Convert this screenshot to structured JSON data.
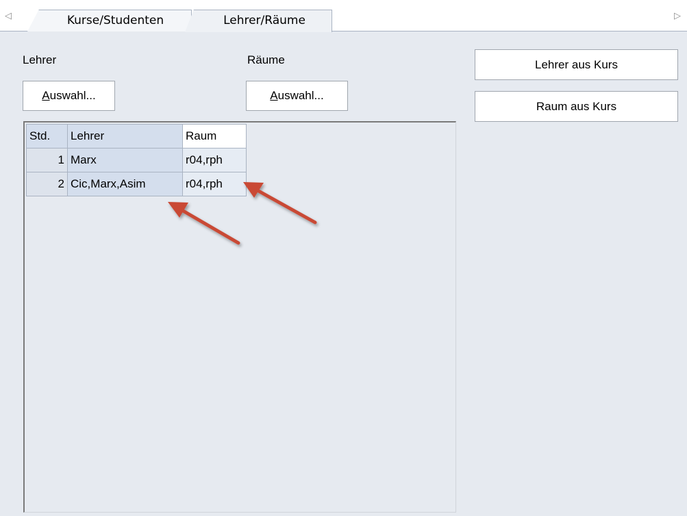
{
  "tabs": [
    {
      "label": "Kurse/Studenten",
      "active": false
    },
    {
      "label": "Lehrer/Räume",
      "active": true
    }
  ],
  "icons": {
    "scroll_left": "triangle-left-icon",
    "scroll_right": "triangle-right-icon"
  },
  "lehrer_section": {
    "label": "Lehrer",
    "button_label": "Auswahl...",
    "button_accel": "A",
    "button_rest": "uswahl..."
  },
  "raeume_section": {
    "label": "Räume",
    "button_label": "Auswahl...",
    "button_accel": "A",
    "button_rest": "uswahl..."
  },
  "side_buttons": [
    {
      "label": "Lehrer aus Kurs"
    },
    {
      "label": "Raum aus Kurs"
    }
  ],
  "grid": {
    "columns": [
      "Std.",
      "Lehrer",
      "Raum"
    ],
    "rows": [
      {
        "std": "1",
        "lehrer": "Marx",
        "raum": "r04,rph"
      },
      {
        "std": "2",
        "lehrer": "Cic,Marx,Asim",
        "raum": "r04,rph"
      }
    ]
  },
  "colors": {
    "annotation_arrow": "#c94a35",
    "selected_cell": "#d4deed",
    "panel_bg": "#e6eaf0"
  }
}
